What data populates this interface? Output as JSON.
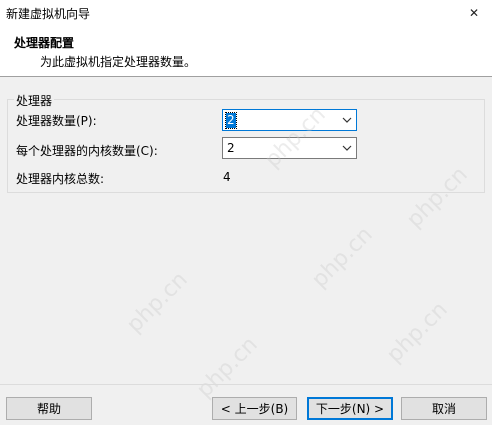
{
  "window": {
    "title": "新建虚拟机向导",
    "close_glyph": "✕"
  },
  "header": {
    "title": "处理器配置",
    "subtitle": "为此虚拟机指定处理器数量。"
  },
  "processor_group": {
    "legend": "处理器",
    "cpu_count_label": "处理器数量(P):",
    "cpu_count_value": "2",
    "cores_label": "每个处理器的内核数量(C):",
    "cores_value": "2",
    "total_label": "处理器内核总数:",
    "total_value": "4"
  },
  "buttons": {
    "help": "帮助",
    "back": "< 上一步(B)",
    "next": "下一步(N) >",
    "cancel": "取消"
  },
  "watermark_text": "php.cn"
}
